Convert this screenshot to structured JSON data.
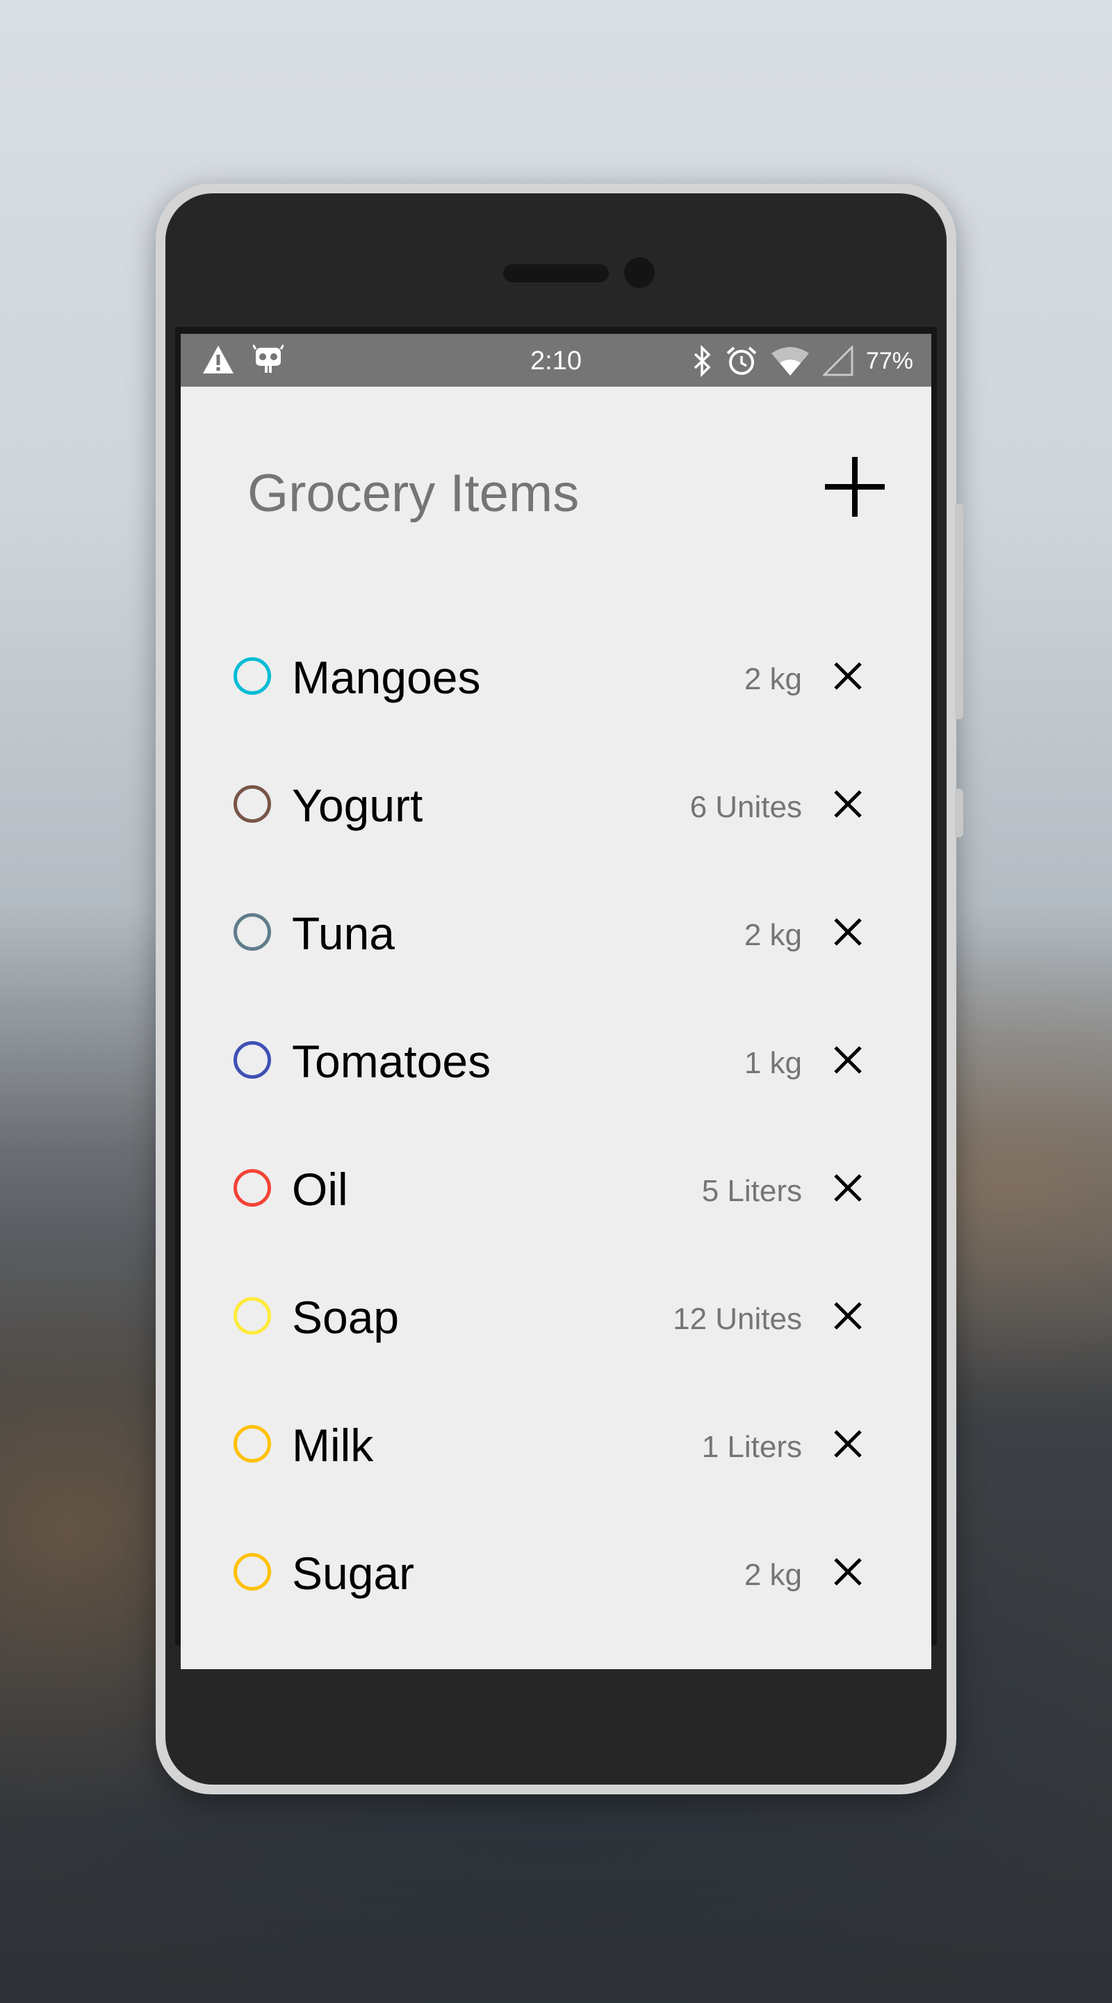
{
  "status_bar": {
    "time": "2:10",
    "battery": "77%",
    "left_icons": [
      "warning-icon",
      "cyanogen-icon"
    ],
    "right_icons": [
      "bluetooth-icon",
      "alarm-icon",
      "wifi-icon",
      "signal-icon"
    ]
  },
  "header": {
    "title": "Grocery Items",
    "add_icon": "plus-icon"
  },
  "items": [
    {
      "name": "Mangoes",
      "quantity": "2 kg",
      "color": "#00bcd4"
    },
    {
      "name": "Yogurt",
      "quantity": "6 Unites",
      "color": "#795548"
    },
    {
      "name": "Tuna",
      "quantity": "2 kg",
      "color": "#607d8b"
    },
    {
      "name": "Tomatoes",
      "quantity": "1 kg",
      "color": "#3f51b5"
    },
    {
      "name": "Oil",
      "quantity": "5 Liters",
      "color": "#f44336"
    },
    {
      "name": "Soap",
      "quantity": "12 Unites",
      "color": "#ffeb3b"
    },
    {
      "name": "Milk",
      "quantity": "1 Liters",
      "color": "#ffc107"
    },
    {
      "name": "Sugar",
      "quantity": "2 kg",
      "color": "#ffc107"
    }
  ],
  "colors": {
    "status_bar": "#757575",
    "screen_background": "#eeeeee",
    "title_text": "#757575",
    "quantity_text": "#757575"
  }
}
